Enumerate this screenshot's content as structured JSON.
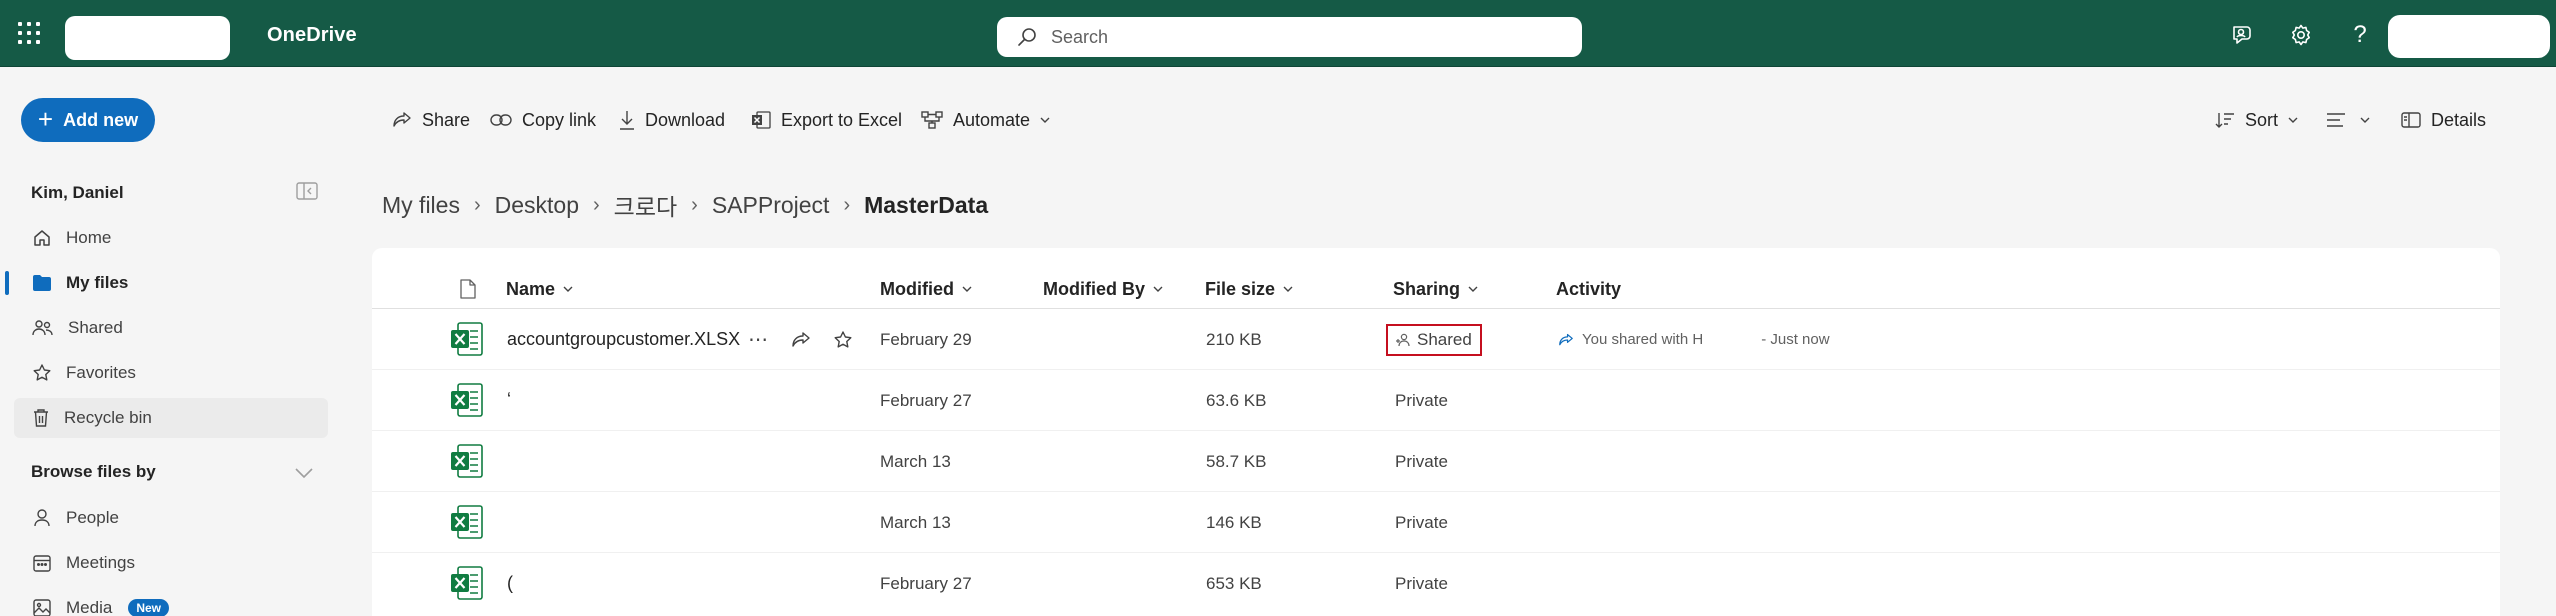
{
  "app": {
    "title": "OneDrive"
  },
  "search": {
    "placeholder": "Search"
  },
  "toolbar_icons": [
    "feedback-icon",
    "settings-icon",
    "help-icon"
  ],
  "sidebar": {
    "add_new_label": "Add new",
    "user_name": "Kim, Daniel",
    "items": [
      {
        "label": "Home",
        "icon": "home-icon"
      },
      {
        "label": "My files",
        "icon": "folder-icon",
        "active": true
      },
      {
        "label": "Shared",
        "icon": "people-icon"
      },
      {
        "label": "Favorites",
        "icon": "star-icon"
      },
      {
        "label": "Recycle bin",
        "icon": "trash-icon"
      }
    ],
    "browse_heading": "Browse files by",
    "browse_items": [
      {
        "label": "People",
        "icon": "person-icon"
      },
      {
        "label": "Meetings",
        "icon": "calendar-icon"
      },
      {
        "label": "Media",
        "icon": "image-icon",
        "badge": "New"
      }
    ]
  },
  "command_bar": {
    "share": "Share",
    "copy_link": "Copy link",
    "download": "Download",
    "export_excel": "Export to Excel",
    "automate": "Automate",
    "sort": "Sort",
    "details": "Details"
  },
  "breadcrumb": [
    "My files",
    "Desktop",
    "크로다",
    "SAPProject",
    "MasterData"
  ],
  "columns": {
    "name": "Name",
    "modified": "Modified",
    "modified_by": "Modified By",
    "file_size": "File size",
    "sharing": "Sharing",
    "activity": "Activity"
  },
  "files": [
    {
      "name": "accountgroupcustomer.XLSX",
      "modified": "February 29",
      "modified_by": "",
      "size": "210 KB",
      "sharing": "Shared",
      "activity_text": "You shared with H",
      "activity_time": "- Just now"
    },
    {
      "name": "ʻ",
      "modified": "February 27",
      "modified_by": "",
      "size": "63.6 KB",
      "sharing": "Private"
    },
    {
      "name": "",
      "modified": "March 13",
      "modified_by": "",
      "size": "58.7 KB",
      "sharing": "Private"
    },
    {
      "name": "",
      "modified": "March 13",
      "modified_by": "",
      "size": "146 KB",
      "sharing": "Private"
    },
    {
      "name": "(",
      "modified": "February 27",
      "modified_by": "",
      "size": "653 KB",
      "sharing": "Private"
    }
  ],
  "colors": {
    "header_bg": "#155a46",
    "accent": "#0f6cbd",
    "highlight_border": "#c50f1f",
    "excel_green": "#107c41"
  }
}
